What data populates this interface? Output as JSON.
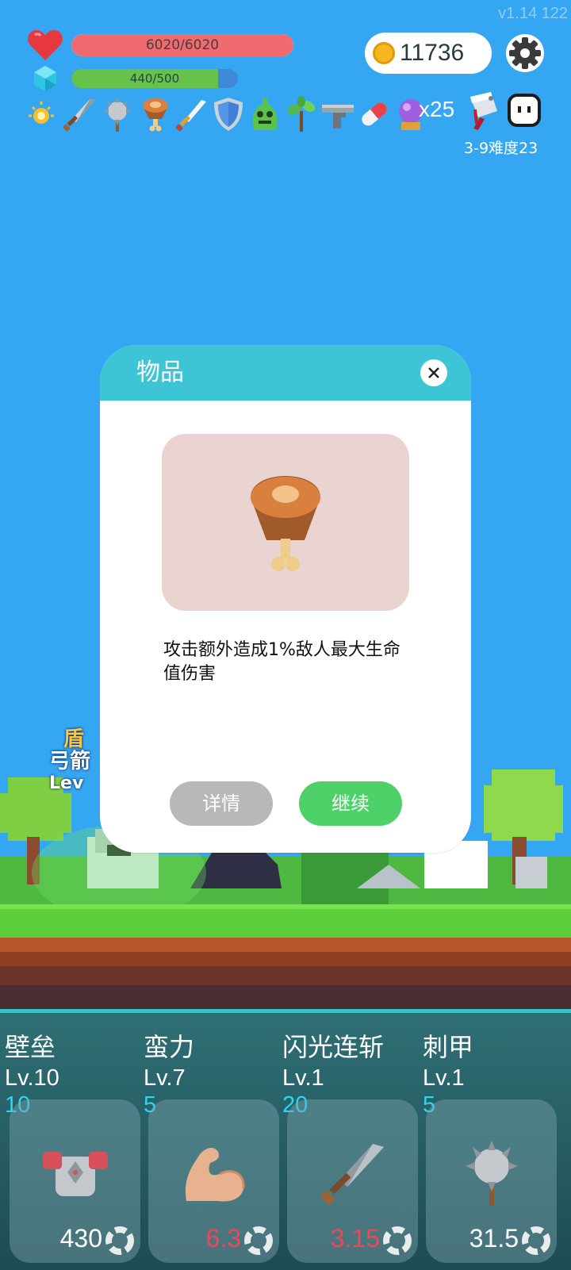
{
  "version": "v1.14 122",
  "hud": {
    "hp_text": "6020/6020",
    "hp_fraction": 1.0,
    "mp_text": "440/500",
    "mp_fraction": 0.88,
    "coins": "11736",
    "multiplier": "x25",
    "stage": "3-9难度23"
  },
  "items": [
    "sun-orb-icon",
    "sword-icon",
    "spiked-mace-icon",
    "meat-drumstick-icon",
    "short-sword-icon",
    "shield-icon",
    "green-slime-icon",
    "sapling-icon",
    "pistol-icon",
    "pill-capsule-icon",
    "crystal-ball-icon"
  ],
  "scene": {
    "floating_text_1": "盾",
    "floating_text_2": "弓箭",
    "floating_text_3": "Lev"
  },
  "modal": {
    "title": "物品",
    "description": "攻击额外造成1%敌人最大生命值伤害",
    "details_label": "详情",
    "continue_label": "继续"
  },
  "skills": [
    {
      "name": "壁垒",
      "level": "Lv.10",
      "cost": "10",
      "value": "430",
      "value_color": "white",
      "icon": "armor-icon"
    },
    {
      "name": "蛮力",
      "level": "Lv.7",
      "cost": "5",
      "value": "6.3",
      "value_color": "red",
      "icon": "flexed-arm-icon"
    },
    {
      "name": "闪光连斩",
      "level": "Lv.1",
      "cost": "20",
      "value": "3.15",
      "value_color": "red",
      "icon": "sword-icon"
    },
    {
      "name": "刺甲",
      "level": "Lv.1",
      "cost": "5",
      "value": "31.5",
      "value_color": "white",
      "icon": "spiked-mace-icon"
    }
  ],
  "colors": {
    "sky": "#34a6f2",
    "modal_header": "#3ec5d5",
    "continue_button": "#4ed168",
    "details_button": "#b8b8b8",
    "cost_text": "#2ad8f0",
    "value_red": "#f0455a"
  }
}
